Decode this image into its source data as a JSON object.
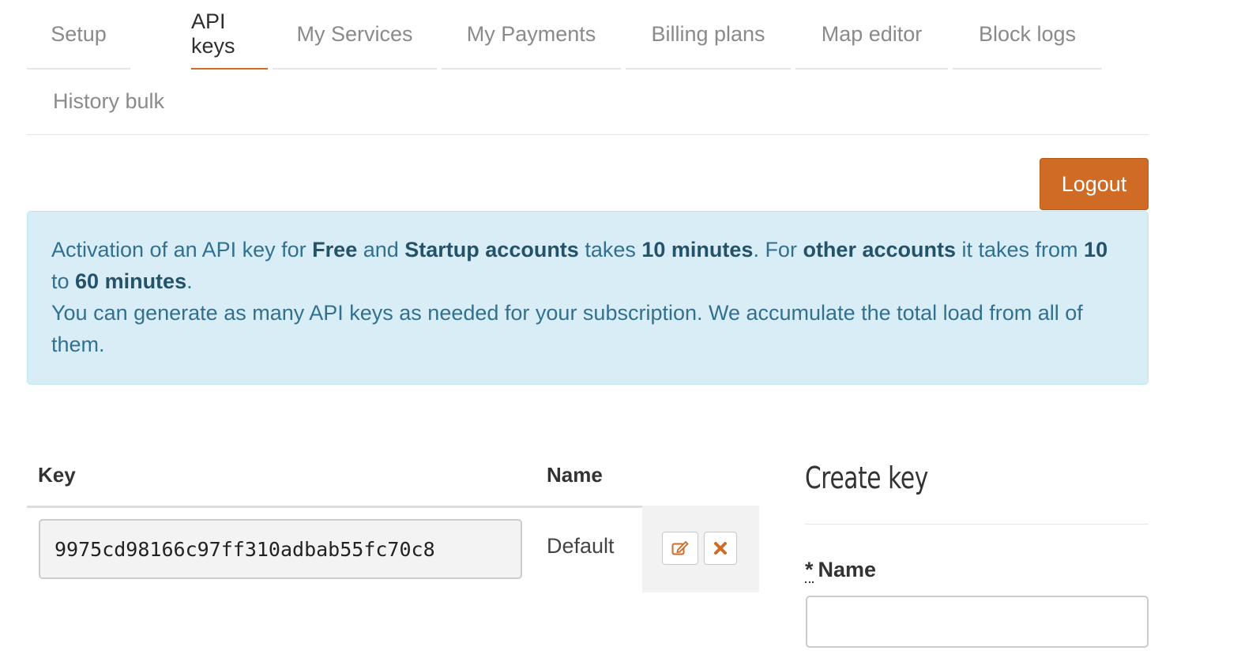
{
  "tabs": [
    {
      "label": "Setup"
    },
    {
      "label": "API keys"
    },
    {
      "label": "My Services"
    },
    {
      "label": "My Payments"
    },
    {
      "label": "Billing plans"
    },
    {
      "label": "Map editor"
    },
    {
      "label": "Block logs"
    },
    {
      "label": "History bulk"
    }
  ],
  "active_tab": "API keys",
  "logout_label": "Logout",
  "info": {
    "p1_a": "Activation of an API key for ",
    "p1_free": "Free",
    "p1_b": " and ",
    "p1_startup": "Startup accounts",
    "p1_c": " takes ",
    "p1_ten_min": "10 minutes",
    "p1_d": ". For ",
    "p1_other": "other accounts",
    "p1_e": " it takes from ",
    "p1_ten": "10",
    "p1_f": " to ",
    "p1_sixty": "60 minutes",
    "p1_g": ".",
    "p2": "You can generate as many API keys as needed for your subscription. We accumulate the total load from all of them."
  },
  "table": {
    "headers": {
      "key": "Key",
      "name": "Name"
    },
    "rows": [
      {
        "key": "9975cd98166c97ff310adbab55fc70c8",
        "name": "Default"
      }
    ]
  },
  "create": {
    "title": "Create key",
    "required_mark": "*",
    "name_label": "Name",
    "name_value": ""
  },
  "colors": {
    "accent": "#d06b25",
    "info_bg": "#d9edf7",
    "info_text": "#31708f"
  }
}
